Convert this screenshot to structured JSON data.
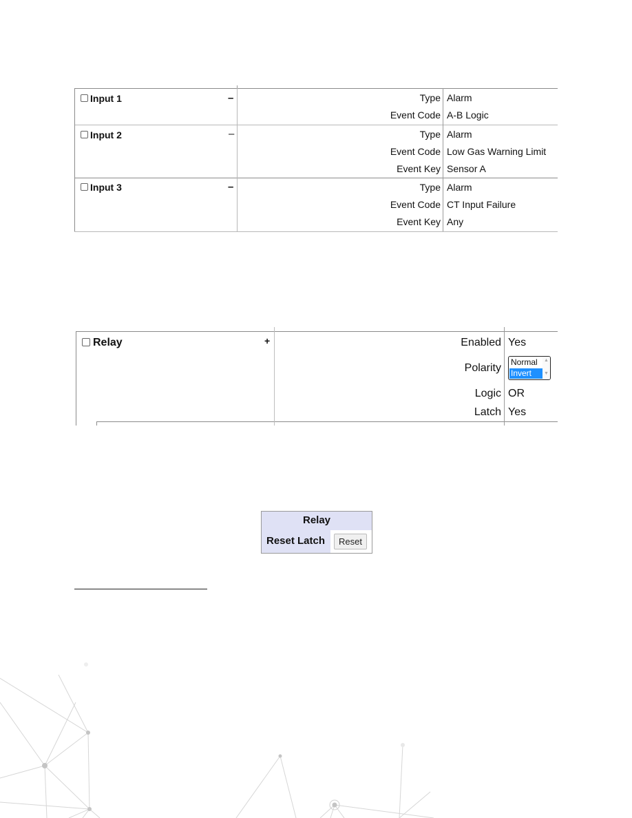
{
  "inputs_table": {
    "rows": [
      {
        "title": "Input 1",
        "toggle": "–",
        "checked": false,
        "fields": [
          {
            "label": "Type",
            "value": "Alarm"
          },
          {
            "label": "Event Code",
            "value": "A-B Logic"
          }
        ]
      },
      {
        "title": "Input 2",
        "toggle": "–",
        "checked": false,
        "fields": [
          {
            "label": "Type",
            "value": "Alarm"
          },
          {
            "label": "Event Code",
            "value": "Low Gas Warning Limit"
          },
          {
            "label": "Event Key",
            "value": "Sensor A"
          }
        ]
      },
      {
        "title": "Input 3",
        "toggle": "–",
        "checked": false,
        "fields": [
          {
            "label": "Type",
            "value": "Alarm"
          },
          {
            "label": "Event Code",
            "value": "CT Input Failure"
          },
          {
            "label": "Event Key",
            "value": "Any"
          }
        ]
      }
    ]
  },
  "relay_table": {
    "title": "Relay",
    "toggle": "+",
    "checked": false,
    "enabled": {
      "label": "Enabled",
      "value": "Yes"
    },
    "polarity": {
      "label": "Polarity",
      "options": [
        "Normal",
        "Invert"
      ],
      "selected": "Invert"
    },
    "logic": {
      "label": "Logic",
      "value": "OR"
    },
    "latch": {
      "label": "Latch",
      "value": "Yes"
    }
  },
  "relay_reset": {
    "header": "Relay",
    "label": "Reset Latch",
    "button_label": "Reset"
  },
  "colors": {
    "selection": "#1e90ff",
    "reset_panel_bg": "#dfe1f5"
  }
}
